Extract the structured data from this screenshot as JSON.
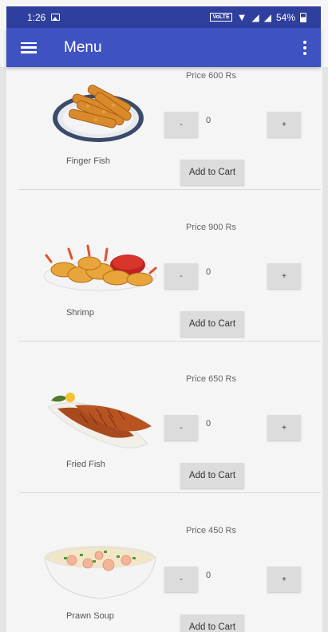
{
  "status_bar": {
    "time": "1:26",
    "battery": "54%",
    "network_badge": "VoLTE"
  },
  "app_bar": {
    "title": "Menu"
  },
  "menu_items": [
    {
      "name": "Finger Fish",
      "price": "Price 600 Rs",
      "quantity": "0",
      "minus_label": "-",
      "plus_label": "+",
      "cart_label": "Add to Cart"
    },
    {
      "name": "Shrimp",
      "price": "Price 900 Rs",
      "quantity": "0",
      "minus_label": "-",
      "plus_label": "+",
      "cart_label": "Add to Cart"
    },
    {
      "name": "Fried Fish",
      "price": "Price 650 Rs",
      "quantity": "0",
      "minus_label": "-",
      "plus_label": "+",
      "cart_label": "Add to Cart"
    },
    {
      "name": "Prawn Soup",
      "price": "Price 450 Rs",
      "quantity": "0",
      "minus_label": "-",
      "plus_label": "+",
      "cart_label": "Add to Cart"
    }
  ],
  "colors": {
    "status_bar": "#2f3f9e",
    "app_bar": "#3e52c1",
    "button": "#dcdcdc"
  }
}
